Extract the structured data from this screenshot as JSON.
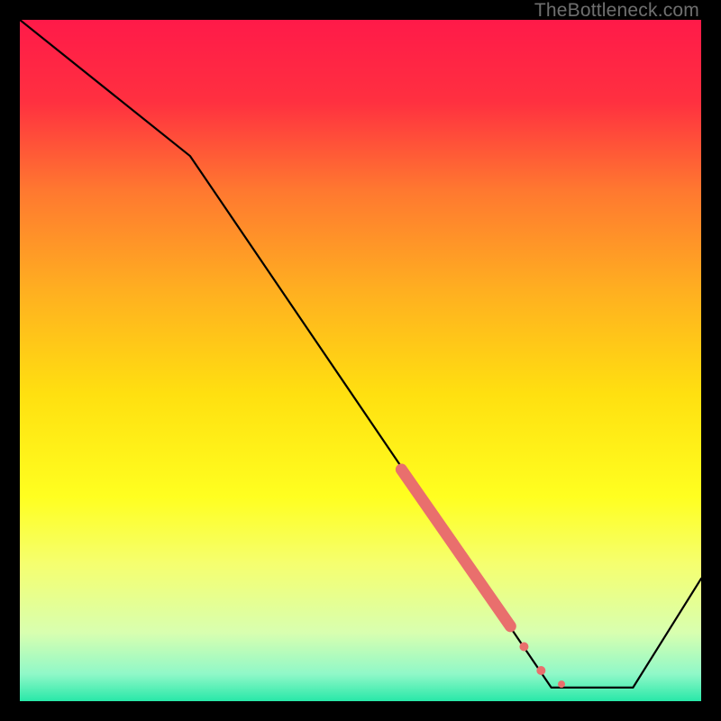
{
  "watermark": "TheBottleneck.com",
  "chart_data": {
    "type": "line",
    "title": "",
    "xlabel": "",
    "ylabel": "",
    "xlim": [
      0,
      100
    ],
    "ylim": [
      0,
      100
    ],
    "gradient_stops": [
      {
        "offset": 0.0,
        "color": "#ff1a49"
      },
      {
        "offset": 0.12,
        "color": "#ff3040"
      },
      {
        "offset": 0.25,
        "color": "#ff7830"
      },
      {
        "offset": 0.4,
        "color": "#ffb020"
      },
      {
        "offset": 0.55,
        "color": "#ffe010"
      },
      {
        "offset": 0.7,
        "color": "#ffff20"
      },
      {
        "offset": 0.8,
        "color": "#f5ff70"
      },
      {
        "offset": 0.9,
        "color": "#d8ffb0"
      },
      {
        "offset": 0.96,
        "color": "#90f8c8"
      },
      {
        "offset": 1.0,
        "color": "#28e8a8"
      }
    ],
    "series": [
      {
        "name": "bottleneck-curve",
        "type": "line",
        "color": "#000000",
        "x": [
          0,
          25,
          78,
          90,
          100
        ],
        "values": [
          100,
          80,
          2,
          2,
          18
        ]
      },
      {
        "name": "thick-segment",
        "type": "line-thick",
        "color": "#e96f6d",
        "x": [
          56,
          72
        ],
        "values": [
          34,
          11
        ]
      }
    ],
    "markers": [
      {
        "x": 71.5,
        "y": 11.5,
        "r": 4,
        "color": "#e96f6d"
      },
      {
        "x": 74,
        "y": 8,
        "r": 5,
        "color": "#e96f6d"
      },
      {
        "x": 76.5,
        "y": 4.5,
        "r": 5,
        "color": "#e96f6d"
      },
      {
        "x": 79.5,
        "y": 2.5,
        "r": 4,
        "color": "#e96f6d"
      }
    ]
  }
}
